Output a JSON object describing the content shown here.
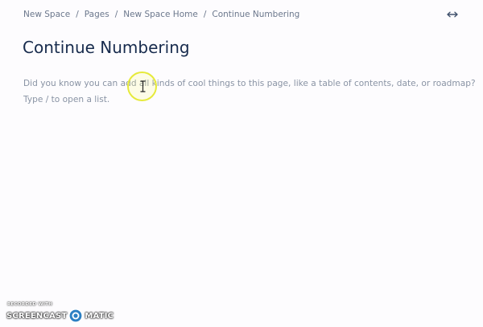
{
  "breadcrumb": {
    "items": [
      "New Space",
      "Pages",
      "New Space Home",
      "Continue Numbering"
    ],
    "separator": "/"
  },
  "header": {
    "expand_icon": "expand-horizontal-icon"
  },
  "page": {
    "title": "Continue Numbering",
    "placeholder_line1": "Did you know you can add all kinds of cool things to this page, like a table of contents, date, or roadmap?",
    "placeholder_line2": "Type / to open a list."
  },
  "cursor": {
    "icon": "text-cursor-icon",
    "highlight_color": "#e6ea3a"
  },
  "watermark": {
    "top_text": "RECORDED WITH",
    "left_text": "SCREENCAST",
    "right_text": "MATIC",
    "logo_icon": "screencast-o-matic-logo-icon"
  },
  "colors": {
    "background": "#fdfcfe",
    "title": "#172b4d",
    "breadcrumb": "#6b778c",
    "placeholder": "#8993a4",
    "logo_blue": "#2c7fc3"
  }
}
